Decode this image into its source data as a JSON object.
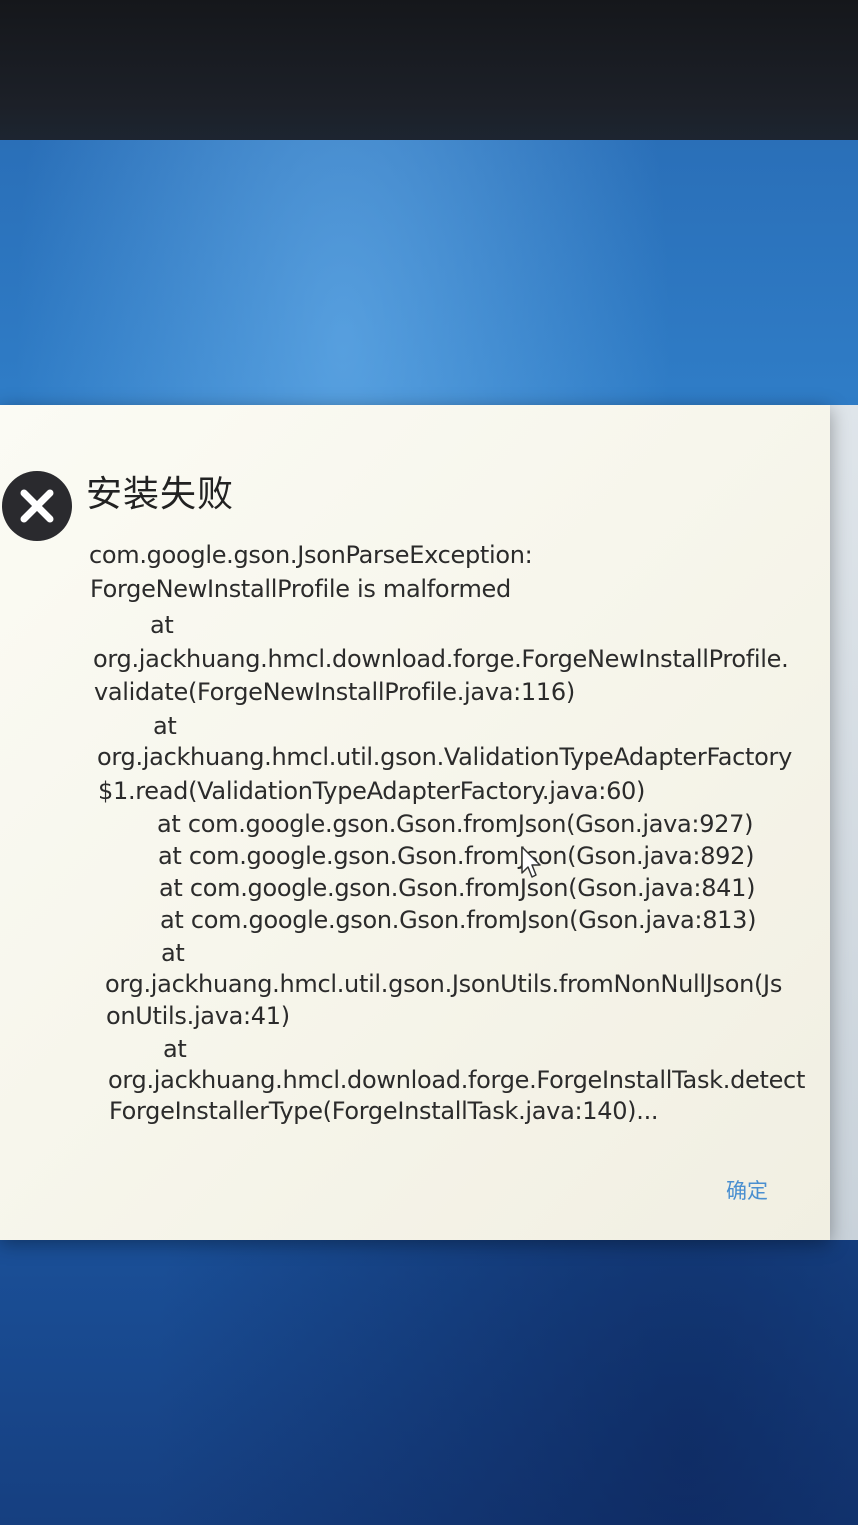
{
  "dialog": {
    "title": "安装失败",
    "icon": "close-circle-icon",
    "message_lines": [
      "com.google.gson.JsonParseException:",
      "ForgeNewInstallProfile is malformed",
      "at",
      "org.jackhuang.hmcl.download.forge.ForgeNewInstallProfile.",
      "validate(ForgeNewInstallProfile.java:116)",
      "at",
      "org.jackhuang.hmcl.util.gson.ValidationTypeAdapterFactory",
      "$1.read(ValidationTypeAdapterFactory.java:60)",
      "at com.google.gson.Gson.fromJson(Gson.java:927)",
      "at com.google.gson.Gson.fromJson(Gson.java:892)",
      "at com.google.gson.Gson.fromJson(Gson.java:841)",
      "at com.google.gson.Gson.fromJson(Gson.java:813)",
      "at",
      "org.jackhuang.hmcl.util.gson.JsonUtils.fromNonNullJson(Js",
      "onUtils.java:41)",
      "at",
      "org.jackhuang.hmcl.download.forge.ForgeInstallTask.detect",
      "ForgeInstallerType(ForgeInstallTask.java:140)..."
    ],
    "ok_label": "确定"
  },
  "colors": {
    "dialog_bg": "#f7f6ec",
    "text": "#2b2b2b",
    "accent": "#4a8fd0",
    "icon_bg": "#2a2a2e"
  }
}
